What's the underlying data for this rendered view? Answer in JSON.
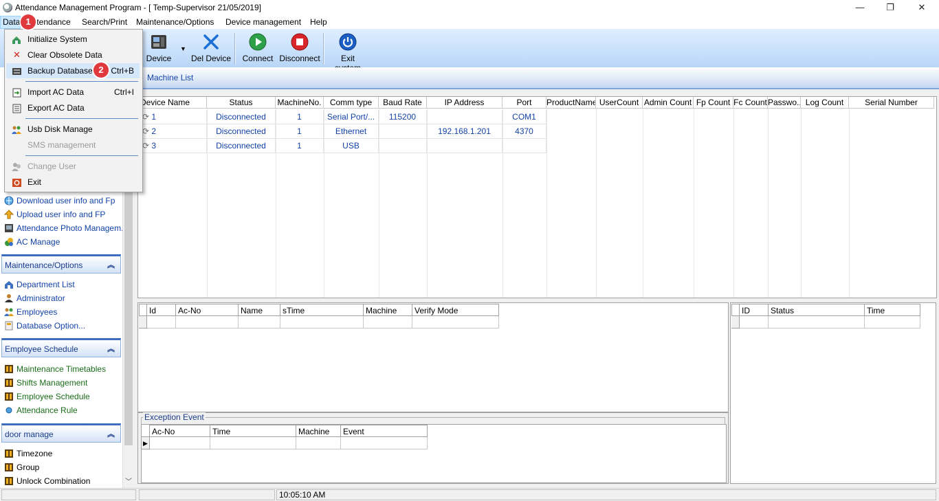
{
  "window": {
    "title": "Attendance Management Program - [ Temp-Supervisor 21/05/2019]",
    "minimize": "—",
    "maximize": "❐",
    "close": "✕"
  },
  "menubar": {
    "items": [
      "Data",
      "Attendance",
      "Search/Print",
      "Maintenance/Options",
      "Device management",
      "Help"
    ]
  },
  "badges": {
    "one": "1",
    "two": "2"
  },
  "toolbar": {
    "buttons": [
      {
        "label": "Device",
        "icon": "device-icon"
      },
      {
        "label": "Del Device",
        "icon": "delete-x-icon"
      },
      {
        "label": "Connect",
        "icon": "play-icon"
      },
      {
        "label": "Disconnect",
        "icon": "stop-icon"
      },
      {
        "label": "Exit system",
        "icon": "power-icon"
      }
    ],
    "colors": {
      "connect": "#2fa04a",
      "disconnect": "#d9262a",
      "exit": "#1b5fc4",
      "delete": "#1a6fd6"
    }
  },
  "data_menu": {
    "items": [
      {
        "label": "Initialize System",
        "shortcut": "",
        "enabled": true,
        "icon": "initialize-icon"
      },
      {
        "label": "Clear Obsolete Data",
        "shortcut": "",
        "enabled": true,
        "icon": "red-x-icon"
      },
      {
        "label": "Backup Database",
        "shortcut": "Ctrl+B",
        "enabled": true,
        "icon": "backup-icon"
      },
      {
        "label": "Import AC Data",
        "shortcut": "Ctrl+I",
        "enabled": true,
        "icon": "import-icon"
      },
      {
        "label": "Export AC Data",
        "shortcut": "",
        "enabled": true,
        "icon": "export-icon"
      },
      {
        "label": "Usb Disk Manage",
        "shortcut": "",
        "enabled": true,
        "icon": "usb-users-icon"
      },
      {
        "label": "SMS management",
        "shortcut": "",
        "enabled": false,
        "icon": ""
      },
      {
        "label": "Change User",
        "shortcut": "",
        "enabled": false,
        "icon": "change-user-icon"
      },
      {
        "label": "Exit",
        "shortcut": "",
        "enabled": true,
        "icon": "exit-icon"
      }
    ]
  },
  "machine_list": {
    "title": "Machine List",
    "columns": [
      "Device Name",
      "Status",
      "MachineNo.",
      "Comm type",
      "Baud Rate",
      "IP Address",
      "Port",
      "ProductName",
      "UserCount",
      "Admin Count",
      "Fp Count",
      "Fc Count",
      "Passwo...",
      "Log Count",
      "Serial Number"
    ],
    "rows": [
      {
        "name": "1",
        "status": "Disconnected",
        "machine_no": "1",
        "comm": "Serial Port/...",
        "baud": "115200",
        "ip": "",
        "port": "COM1"
      },
      {
        "name": "2",
        "status": "Disconnected",
        "machine_no": "1",
        "comm": "Ethernet",
        "baud": "",
        "ip": "192.168.1.201",
        "port": "4370"
      },
      {
        "name": "3",
        "status": "Disconnected",
        "machine_no": "1",
        "comm": "USB",
        "baud": "",
        "ip": "",
        "port": ""
      }
    ]
  },
  "left_panel": {
    "items_top": [
      {
        "label": "Download user info and Fp",
        "icon": "download-globe-icon"
      },
      {
        "label": "Upload user info and FP",
        "icon": "upload-arrow-icon"
      },
      {
        "label": "Attendance Photo Managem...",
        "icon": "photo-icon"
      },
      {
        "label": "AC Manage",
        "icon": "ac-manage-icon"
      }
    ],
    "section_maintenance": "Maintenance/Options",
    "items_maintenance": [
      {
        "label": "Department List",
        "icon": "department-icon"
      },
      {
        "label": "Administrator",
        "icon": "administrator-icon"
      },
      {
        "label": "Employees",
        "icon": "employees-icon"
      },
      {
        "label": "Database Option...",
        "icon": "database-icon"
      }
    ],
    "section_schedule": "Employee Schedule",
    "items_schedule": [
      {
        "label": "Maintenance Timetables",
        "icon": "timetable-icon"
      },
      {
        "label": "Shifts Management",
        "icon": "shifts-icon"
      },
      {
        "label": "Employee Schedule",
        "icon": "schedule-icon"
      },
      {
        "label": "Attendance Rule",
        "icon": "rule-icon"
      }
    ],
    "section_door": "door manage",
    "items_door": [
      {
        "label": "Timezone",
        "icon": "timezone-icon"
      },
      {
        "label": "Group",
        "icon": "group-icon"
      },
      {
        "label": "Unlock Combination",
        "icon": "unlock-icon"
      }
    ],
    "collapse_glyph": "«"
  },
  "log_grid": {
    "columns": [
      "Id",
      "Ac-No",
      "Name",
      "sTime",
      "Machine",
      "Verify Mode"
    ]
  },
  "status_grid": {
    "columns": [
      "ID",
      "Status",
      "Time"
    ]
  },
  "exception_event": {
    "title": "Exception Event",
    "columns": [
      "Ac-No",
      "Time",
      "Machine",
      "Event"
    ]
  },
  "statusbar": {
    "time": "10:05:10 AM"
  }
}
